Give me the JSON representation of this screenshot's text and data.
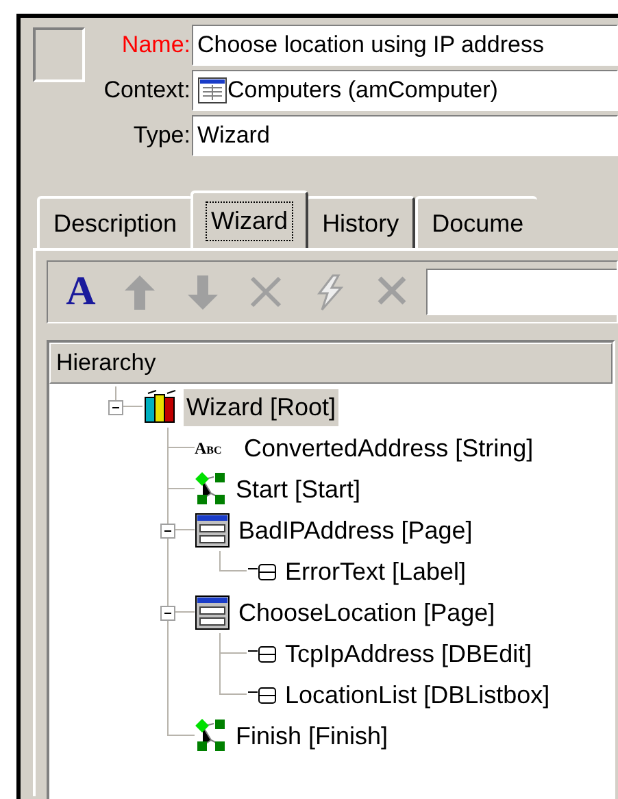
{
  "form": {
    "fields": [
      {
        "label": "Name:",
        "value": "Choose location using IP address",
        "required": true,
        "kind": "text"
      },
      {
        "label": "Context:",
        "value": "Computers (amComputer)",
        "required": false,
        "kind": "table"
      },
      {
        "label": "Type:",
        "value": "Wizard",
        "required": false,
        "kind": "text"
      }
    ]
  },
  "tabs": [
    {
      "label": "Description",
      "selected": false
    },
    {
      "label": "Wizard",
      "selected": true
    },
    {
      "label": "History",
      "selected": false
    },
    {
      "label": "Docume",
      "selected": false
    }
  ],
  "toolbar": {
    "buttons": [
      {
        "kind": "font",
        "text": "A",
        "disabled": false
      },
      {
        "kind": "up",
        "disabled": true
      },
      {
        "kind": "down",
        "disabled": true
      },
      {
        "kind": "cut",
        "disabled": true
      },
      {
        "kind": "bolt",
        "disabled": true
      },
      {
        "kind": "delete",
        "disabled": true
      }
    ]
  },
  "hierarchy": {
    "header": "Hierarchy",
    "tree": [
      {
        "label": "Wizard [Root]",
        "kind": "root",
        "selected": true,
        "expanded": true,
        "children": [
          {
            "label": "ConvertedAddress [String]",
            "kind": "string",
            "icon_text": "Abc",
            "selected": false
          },
          {
            "label": "Start [Start]",
            "kind": "step",
            "selected": false
          },
          {
            "label": "BadIPAddress [Page]",
            "kind": "page",
            "selected": false,
            "expanded": true,
            "children": [
              {
                "label": "ErrorText [Label]",
                "kind": "control",
                "selected": false
              }
            ]
          },
          {
            "label": "ChooseLocation [Page]",
            "kind": "page",
            "selected": false,
            "expanded": true,
            "children": [
              {
                "label": "TcpIpAddress [DBEdit]",
                "kind": "control",
                "selected": false
              },
              {
                "label": "LocationList [DBListbox]",
                "kind": "control",
                "selected": false
              }
            ]
          },
          {
            "label": "Finish [Finish]",
            "kind": "step",
            "selected": false
          }
        ]
      }
    ]
  }
}
